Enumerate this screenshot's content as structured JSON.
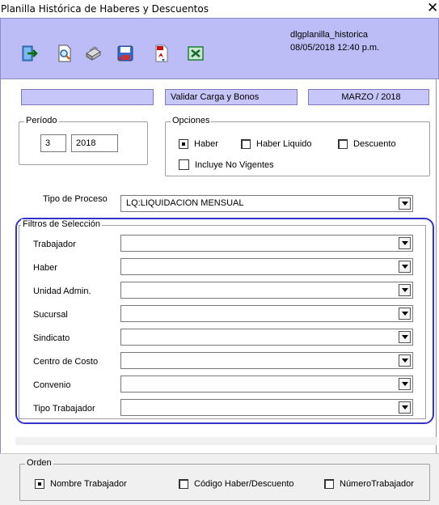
{
  "window": {
    "title": "Planilla Histórica de Haberes y Descuentos",
    "close_glyph": "✕"
  },
  "toolbar": {
    "icons": [
      "exit-icon",
      "print-preview-icon",
      "print-icon",
      "save-icon",
      "pdf-icon",
      "excel-icon"
    ],
    "app_name": "dlgplanilla_historica",
    "datetime": "08/05/2018 12:40 p.m."
  },
  "header": {
    "status_box": "",
    "validate_label": "Validar Carga y Bonos",
    "month_period": "MARZO / 2018"
  },
  "periodo": {
    "legend": "Período",
    "month": "3",
    "year": "2018"
  },
  "opciones": {
    "legend": "Opciones",
    "haber": "Haber",
    "haber_liquido": "Haber Liquido",
    "descuento": "Descuento",
    "no_vigentes": "Incluye No Vigentes",
    "selected": "haber"
  },
  "tipo_proceso": {
    "label": "Tipo de Proceso",
    "value": "LQ:LIQUIDACION MENSUAL"
  },
  "filtros": {
    "legend": "Filtros de Selección",
    "fields": [
      {
        "label": "Trabajador",
        "value": ""
      },
      {
        "label": "Haber",
        "value": ""
      },
      {
        "label": "Unidad Admin.",
        "value": ""
      },
      {
        "label": "Sucursal",
        "value": ""
      },
      {
        "label": "Sindicato",
        "value": ""
      },
      {
        "label": "Centro de Costo",
        "value": ""
      },
      {
        "label": "Convenio",
        "value": ""
      },
      {
        "label": "Tipo Trabajador",
        "value": ""
      }
    ]
  },
  "orden": {
    "legend": "Orden",
    "nombre": "Nombre Trabajador",
    "codigo": "Código Haber/Descuento",
    "numero": "NúmeroTrabajador",
    "selected": "nombre"
  },
  "colors": {
    "accent_purple": "#c7c6f8",
    "toolbar_purple": "#bcbcf7",
    "filter_border": "#3333cc"
  }
}
